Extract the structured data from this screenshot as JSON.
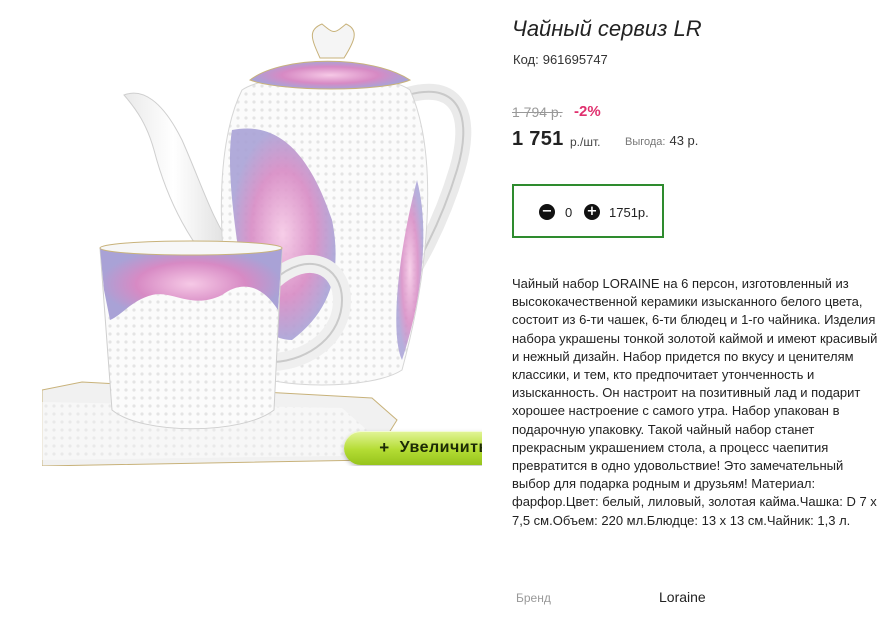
{
  "product": {
    "title": "Чайный сервиз LR",
    "sku_label": "Код:",
    "sku": "961695747",
    "old_price": "1 794 р.",
    "discount": "-2%",
    "price": "1 751",
    "price_unit": "р./шт.",
    "saving_label": "Выгода:",
    "saving_value": "43 р.",
    "description": "Чайный набор LORAINE на 6 персон, изготовленный из высококачественной керамики изысканного белого цвета, состоит из 6-ти чашек, 6-ти блюдец и 1-го чайника. Изделия набора украшены тонкой золотой каймой и имеют красивый и нежный дизайн. Набор придется по вкусу и ценителям классики, и тем, кто предпочитает утонченность и изысканность. Он настроит на позитивный лад и подарит хорошее настроение с самого утра. Набор упакован в подарочную упаковку. Такой чайный набор станет прекрасным украшением стола, а процесс чаепития превратится в одно удовольствие! Это замечательный выбор для подарка родным и друзьям! Материал: фарфор.Цвет: белый, лиловый, золотая кайма.Чашка: D 7 х 7,5 см.Объем: 220 мл.Блюдце: 13 х 13 см.Чайник: 1,3 л.",
    "brand_label": "Бренд",
    "brand_value": "Loraine"
  },
  "quantity": {
    "minus_icon": "minus-circle-icon",
    "plus_icon": "plus-circle-icon",
    "minus_symbol": "−",
    "plus_symbol": "+",
    "value": "0",
    "total": "1751р."
  },
  "zoom": {
    "plus": "+",
    "label": "Увеличить"
  },
  "colors": {
    "accent_green": "#2e8b2e",
    "discount_pink": "#e0306e",
    "zoom_button": "#b4dc34",
    "floral": "#d98cc4"
  }
}
